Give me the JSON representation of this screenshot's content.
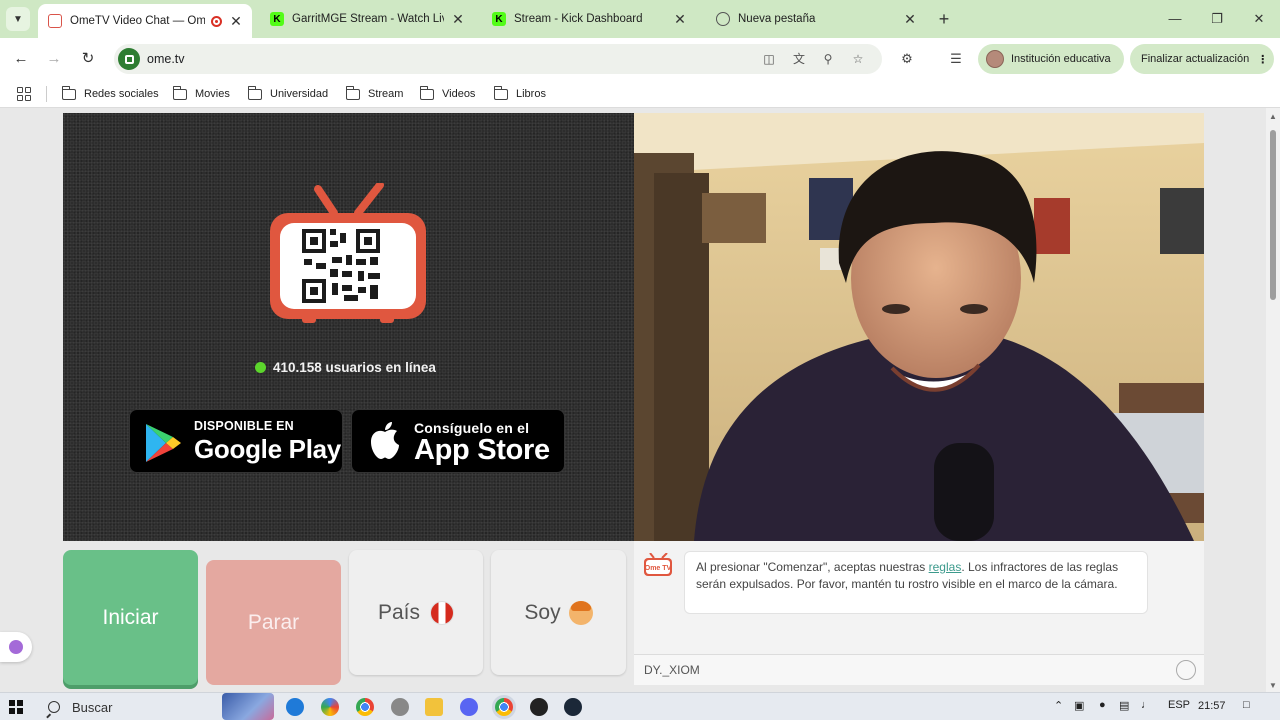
{
  "browser": {
    "tabs": [
      {
        "title": "OmeTV Video Chat — Ome",
        "active": true
      },
      {
        "title": "GarritMGE Stream - Watch Live",
        "active": false
      },
      {
        "title": "Stream - Kick Dashboard",
        "active": false
      },
      {
        "title": "Nueva pestaña",
        "active": false
      }
    ],
    "url": "ome.tv",
    "profile_label": "Institución educativa",
    "update_label": "Finalizar actualización",
    "bookmarks": [
      "Redes sociales",
      "Movies",
      "Universidad",
      "Stream",
      "Videos",
      "Libros"
    ]
  },
  "page": {
    "online_text": "410.158 usuarios en línea",
    "google_play": {
      "small": "DISPONIBLE EN",
      "big": "Google Play"
    },
    "app_store": {
      "small": "Consíguelo en el",
      "big": "App Store"
    },
    "buttons": {
      "start": "Iniciar",
      "stop": "Parar",
      "country": "País",
      "me": "Soy"
    },
    "chat_logo": "Ome TV",
    "chat": {
      "msg_before": "Al presionar \"Comenzar\", aceptas nuestras ",
      "msg_link": "reglas",
      "msg_after": ". Los infractores de las reglas serán expulsados. Por favor, mantén tu rostro visible en el marco de la cámara.",
      "input_value": "DY._XIOM"
    }
  },
  "taskbar": {
    "search_label": "Buscar",
    "language": "ESP",
    "time": "21:57"
  },
  "colors": {
    "accent_green": "#69c088",
    "stop_red": "#e4a8a0",
    "tab_strip": "#cfe8c4",
    "ometv_orange": "#e0573f"
  }
}
